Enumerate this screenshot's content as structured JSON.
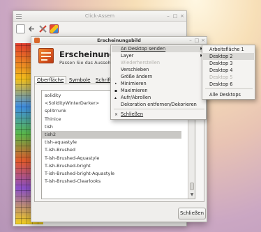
{
  "background_window": {
    "title": "Click-Assem",
    "controls": [
      "–",
      "□",
      "×"
    ],
    "toolbar_icons": [
      "new-document-icon",
      "back-icon",
      "tools-icon",
      "color-palette-icon"
    ]
  },
  "dialog": {
    "title": "Erscheinungsbild",
    "header_title": "Erscheinungsbild",
    "header_subtitle": "Passen Sie das Aussehen",
    "controls": [
      "–",
      "□",
      "×"
    ],
    "tabs": [
      {
        "label": "Oberfläche",
        "active": true
      },
      {
        "label": "Symbole",
        "active": false
      },
      {
        "label": "Schrifta",
        "active": false
      }
    ],
    "list_items": [
      "solidity",
      "<SolidityWinterDarker>",
      "splitrrunk",
      "Thinice",
      "tish",
      "tish2",
      "tish-aquastyle",
      "T-ish-Brushed",
      "T-ish-Brushed-Aquastyle",
      "T-ish-Brushed-bright",
      "T-ish-Brushed-bright-Aquastyle",
      "T-ish-Brushed-Clearlooks"
    ],
    "selected_item": "tish2",
    "close_label": "Schließen"
  },
  "context_menu": {
    "items": [
      {
        "label": "An Desktop senden",
        "submenu": true,
        "highlight": true,
        "disabled": false
      },
      {
        "label": "Layer",
        "submenu": true,
        "highlight": false,
        "disabled": false
      },
      {
        "label": "Wiederherstellen",
        "submenu": false,
        "highlight": false,
        "disabled": true
      },
      {
        "label": "Verschieben",
        "submenu": false,
        "highlight": false,
        "disabled": false
      },
      {
        "label": "Größe ändern",
        "submenu": false,
        "highlight": false,
        "disabled": false
      },
      {
        "label": "Minimieren",
        "submenu": false,
        "highlight": false,
        "disabled": false,
        "bullet": "•"
      },
      {
        "label": "Maximieren",
        "submenu": false,
        "highlight": false,
        "disabled": false,
        "bullet": "▪"
      },
      {
        "label": "Aufr/Abrollen",
        "submenu": false,
        "highlight": false,
        "disabled": false,
        "bullet": "▴"
      },
      {
        "label": "Dekoration entfernen/Dekorieren",
        "submenu": false,
        "highlight": false,
        "disabled": false
      },
      {
        "label": "Schließen",
        "submenu": false,
        "highlight": false,
        "disabled": false,
        "bullet": "×"
      }
    ]
  },
  "submenu": {
    "items": [
      {
        "label": "Arbeitsfläche 1",
        "highlight": false,
        "disabled": false
      },
      {
        "label": "Desktop 2",
        "highlight": true,
        "disabled": false
      },
      {
        "label": "Desktop 3",
        "highlight": false,
        "disabled": false
      },
      {
        "label": "Desktop 4",
        "highlight": false,
        "disabled": false
      },
      {
        "label": "Desktop 5",
        "highlight": false,
        "disabled": true
      },
      {
        "label": "Desktop 6",
        "highlight": false,
        "disabled": false
      },
      {
        "label": "Alle Desktops",
        "highlight": false,
        "disabled": false
      }
    ]
  },
  "colors": {
    "accent_orange": "#d8531c",
    "menu_highlight": "#d9d8d5",
    "selected_row": "#c9c8c5"
  }
}
